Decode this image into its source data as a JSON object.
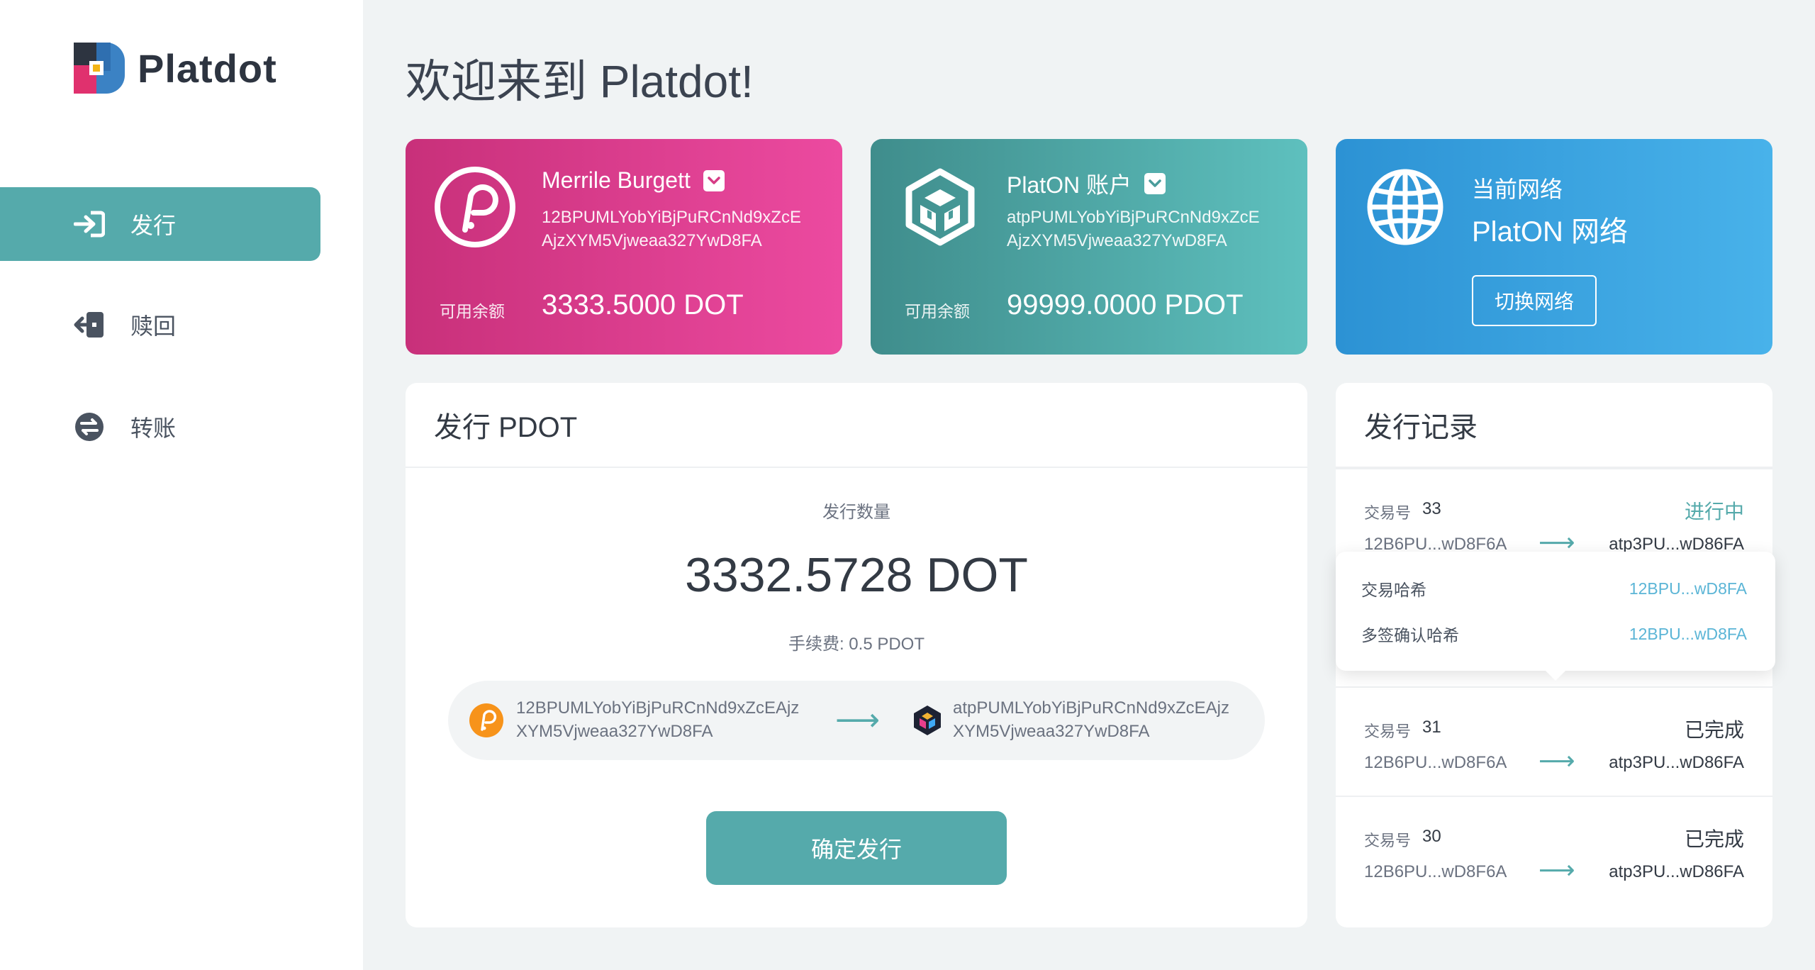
{
  "app": {
    "name": "Platdot",
    "welcome": "欢迎来到 Platdot!"
  },
  "sidebar": {
    "items": [
      {
        "label": "发行",
        "icon": "sign-in-icon",
        "active": true
      },
      {
        "label": "赎回",
        "icon": "sign-out-icon",
        "active": false
      },
      {
        "label": "转账",
        "icon": "exchange-icon",
        "active": false
      }
    ]
  },
  "cards": {
    "polkadot": {
      "name": "Merrile Burgett",
      "address": "12BPUMLYobYiBjPuRCnNd9xZcEAjzXYM5Vjweaa327YwD8FA",
      "address_line1": "12BPUMLYobYiBjPuRCnNd9xZcE",
      "address_line2": "AjzXYM5Vjweaa327YwD8FA",
      "balance_label": "可用余额",
      "balance": "3333.5000 DOT",
      "icon": "polkadot-icon"
    },
    "platon": {
      "name": "PlatON 账户",
      "address_line1": "atpPUMLYobYiBjPuRCnNd9xZcE",
      "address_line2": "AjzXYM5Vjweaa327YwD8FA",
      "balance_label": "可用余额",
      "balance": "99999.0000 PDOT",
      "icon": "platon-cube-icon"
    },
    "network": {
      "label": "当前网络",
      "name": "PlatON 网络",
      "switch_label": "切换网络",
      "icon": "globe-icon"
    }
  },
  "issue": {
    "title": "发行 PDOT",
    "qty_label": "发行数量",
    "amount": "3332.5728 DOT",
    "fee": "手续费: 0.5 PDOT",
    "from_line1": "12BPUMLYobYiBjPuRCnNd9xZcEAjz",
    "from_line2": "XYM5Vjweaa327YwD8FA",
    "to_line1": "atpPUMLYobYiBjPuRCnNd9xZcEAjz",
    "to_line2": "XYM5Vjweaa327YwD8FA",
    "arrow": "⟶",
    "confirm_label": "确定发行"
  },
  "records": {
    "title": "发行记录",
    "tx_label": "交易号",
    "items": [
      {
        "txid": "33",
        "status": "进行中",
        "from": "12B6PU...wD8F6A",
        "to": "atp3PU...wD86FA"
      },
      {
        "txid": "31",
        "status": "已完成",
        "from": "12B6PU...wD8F6A",
        "to": "atp3PU...wD86FA"
      },
      {
        "txid": "30",
        "status": "已完成",
        "from": "12B6PU...wD8F6A",
        "to": "atp3PU...wD86FA"
      }
    ],
    "popover": {
      "hash_label": "交易哈希",
      "hash_value": "12BPU...wD8FA",
      "multisig_label": "多签确认哈希",
      "multisig_value": "12BPU...wD8FA"
    }
  },
  "colors": {
    "accent": "#55aaab",
    "pink_start": "#c8307a",
    "pink_end": "#ec4aa0",
    "blue_start": "#2c92d4",
    "blue_end": "#48b2ea",
    "link": "#5bb5d6"
  }
}
